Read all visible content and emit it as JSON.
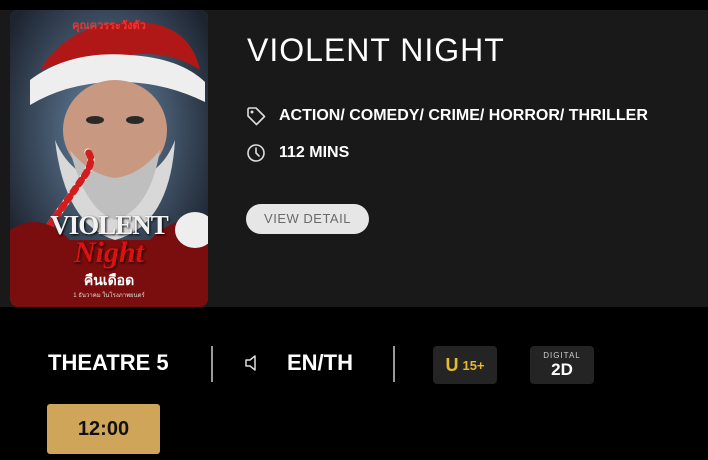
{
  "movie": {
    "title": "VIOLENT NIGHT",
    "genres": "ACTION/ COMEDY/ CRIME/ HORROR/ THRILLER",
    "duration": "112 MINS",
    "view_detail_label": "VIEW DETAIL",
    "poster": {
      "tagline": "คุณควรระวังตัว",
      "title_line1": "VIOLENT",
      "title_line2": "Night",
      "thai_title": "คืนเดือด",
      "release_text": "1 ธันวาคม ในโรงภาพยนตร์"
    }
  },
  "showtime": {
    "theatre": "THEATRE 5",
    "language": "EN/TH",
    "rating_prefix": "U",
    "rating_age": "15+",
    "format_top": "DIGITAL",
    "format_bottom": "2D",
    "times": [
      "12:00"
    ]
  },
  "icons": {
    "genre": "tag-icon",
    "duration": "clock-icon",
    "language": "speaker-icon"
  },
  "colors": {
    "background": "#000000",
    "card": "#191919",
    "time_button": "#cfa55a",
    "rating": "#e8b830"
  }
}
